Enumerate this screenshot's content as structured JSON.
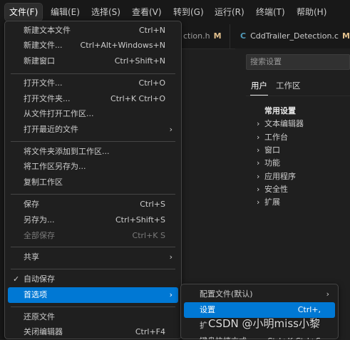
{
  "menubar": {
    "items": [
      "文件(F)",
      "编辑(E)",
      "选择(S)",
      "查看(V)",
      "转到(G)",
      "运行(R)",
      "终端(T)",
      "帮助(H)"
    ]
  },
  "tabs": [
    {
      "label": "ction.h",
      "badge": "M"
    },
    {
      "icon": "C",
      "label": "CddTrailer_Detection.c",
      "badge": "M"
    }
  ],
  "settings": {
    "search_placeholder": "搜索设置",
    "tabs": [
      "用户",
      "工作区"
    ],
    "group_title": "常用设置",
    "items": [
      "文本编辑器",
      "工作台",
      "窗口",
      "功能",
      "应用程序",
      "安全性",
      "扩展"
    ]
  },
  "file_menu": {
    "new_text_file": {
      "label": "新建文本文件",
      "key": "Ctrl+N"
    },
    "new_file": {
      "label": "新建文件...",
      "key": "Ctrl+Alt+Windows+N"
    },
    "new_window": {
      "label": "新建窗口",
      "key": "Ctrl+Shift+N"
    },
    "open_file": {
      "label": "打开文件...",
      "key": "Ctrl+O"
    },
    "open_folder": {
      "label": "打开文件夹...",
      "key": "Ctrl+K Ctrl+O"
    },
    "open_workspace": {
      "label": "从文件打开工作区..."
    },
    "open_recent": {
      "label": "打开最近的文件"
    },
    "add_folder": {
      "label": "将文件夹添加到工作区..."
    },
    "save_workspace_as": {
      "label": "将工作区另存为..."
    },
    "duplicate_workspace": {
      "label": "复制工作区"
    },
    "save": {
      "label": "保存",
      "key": "Ctrl+S"
    },
    "save_as": {
      "label": "另存为...",
      "key": "Ctrl+Shift+S"
    },
    "save_all": {
      "label": "全部保存",
      "key": "Ctrl+K S"
    },
    "share": {
      "label": "共享"
    },
    "auto_save": {
      "label": "自动保存"
    },
    "preferences": {
      "label": "首选项"
    },
    "revert": {
      "label": "还原文件"
    },
    "close_editor": {
      "label": "关闭编辑器",
      "key": "Ctrl+F4"
    }
  },
  "submenu": {
    "profiles": {
      "label": "配置文件(默认)"
    },
    "settings": {
      "label": "设置",
      "key": "Ctrl+,"
    },
    "partial1": {
      "label": "扩"
    },
    "partial2": {
      "label": "键盘快捷方式",
      "key": "Ctrl+K Ctrl+S"
    }
  },
  "watermark": "CSDN @小明miss小黎",
  "colors": {
    "accent": "#0078d4",
    "menu_bg": "#1f1f1f",
    "modified": "#e2c08d"
  }
}
